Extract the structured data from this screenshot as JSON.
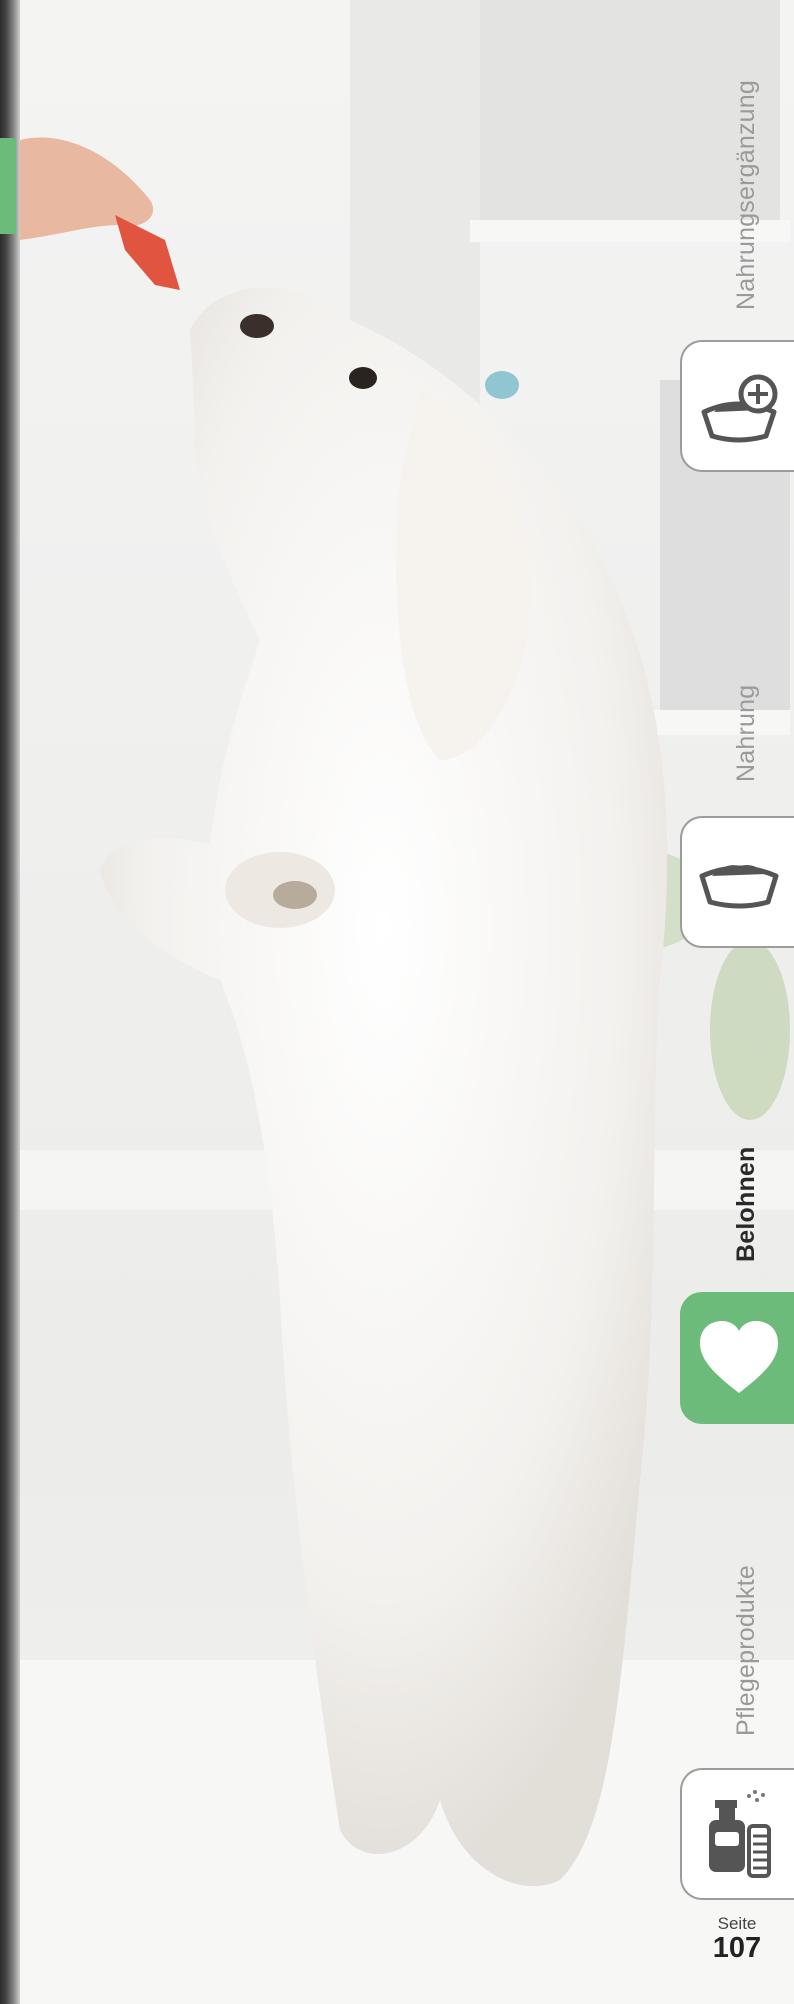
{
  "nav": {
    "items": [
      {
        "label": "Nahrungsergänzung",
        "icon": "food-bowl-plus-icon",
        "active": false
      },
      {
        "label": "Nahrung",
        "icon": "food-bowl-icon",
        "active": false
      },
      {
        "label": "Belohnen",
        "icon": "heart-icon",
        "active": true
      },
      {
        "label": "Pflegeprodukte",
        "icon": "spray-bottle-brush-icon",
        "active": false
      }
    ]
  },
  "page": {
    "label": "Seite",
    "number": "107"
  },
  "colors": {
    "accent": "#6dbb7a",
    "inactive_text": "#9a9a9a",
    "active_text": "#2a2a2a"
  }
}
